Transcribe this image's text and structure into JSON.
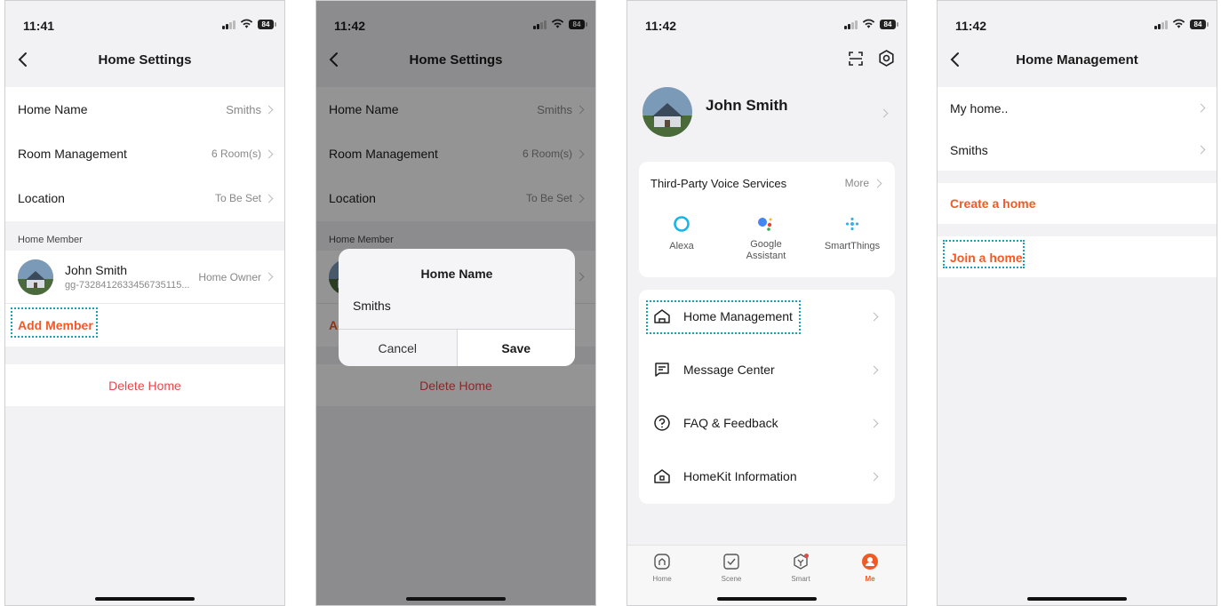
{
  "colors": {
    "accent": "#f25a25",
    "danger": "#e8474a",
    "highlight": "#1aa1b8"
  },
  "p1": {
    "status": {
      "time": "11:41",
      "battery": "84"
    },
    "nav_title": "Home Settings",
    "rows": [
      {
        "label": "Home Name",
        "value": "Smiths"
      },
      {
        "label": "Room Management",
        "value": "6 Room(s)"
      },
      {
        "label": "Location",
        "value": "To Be Set"
      }
    ],
    "member_section": "Home Member",
    "member": {
      "name": "John Smith",
      "id": "gg-7328412633456735115...",
      "role": "Home Owner"
    },
    "add_member": "Add Member",
    "delete_home": "Delete Home"
  },
  "p2": {
    "status": {
      "time": "11:42",
      "battery": "84"
    },
    "nav_title": "Home Settings",
    "rows": [
      {
        "label": "Home Name",
        "value": "Smiths"
      },
      {
        "label": "Room Management",
        "value": "6 Room(s)"
      },
      {
        "label": "Location",
        "value": "To Be Set"
      }
    ],
    "member_section": "Home Member",
    "add_member_partial": "Ac",
    "delete_home": "Delete Home",
    "dialog": {
      "title": "Home Name",
      "input_value": "Smiths",
      "cancel": "Cancel",
      "save": "Save"
    }
  },
  "p3": {
    "status": {
      "time": "11:42",
      "battery": "84"
    },
    "icons": [
      "scan-icon",
      "settings-icon"
    ],
    "profile_name": "John Smith",
    "voice": {
      "title": "Third-Party Voice Services",
      "more": "More",
      "services": [
        {
          "label": "Alexa",
          "icon": "alexa-icon"
        },
        {
          "label": "Google\nAssistant",
          "icon": "google-assistant-icon"
        },
        {
          "label": "SmartThings",
          "icon": "smartthings-icon"
        }
      ]
    },
    "menu": [
      {
        "label": "Home Management",
        "icon": "home-icon"
      },
      {
        "label": "Message Center",
        "icon": "message-icon"
      },
      {
        "label": "FAQ & Feedback",
        "icon": "question-icon"
      },
      {
        "label": "HomeKit Information",
        "icon": "homekit-icon"
      }
    ],
    "tabs": [
      {
        "label": "Home",
        "icon": "home-tab-icon"
      },
      {
        "label": "Scene",
        "icon": "scene-icon"
      },
      {
        "label": "Smart",
        "icon": "smart-icon"
      },
      {
        "label": "Me",
        "icon": "me-icon"
      }
    ]
  },
  "p4": {
    "status": {
      "time": "11:42",
      "battery": "84"
    },
    "nav_title": "Home Management",
    "homes": [
      "My home..",
      "Smiths"
    ],
    "create": "Create a home",
    "join": "Join a home"
  }
}
